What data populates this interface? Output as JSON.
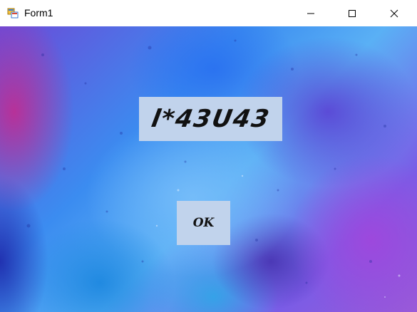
{
  "window": {
    "title": "Form1",
    "icon": "winforms-app-icon"
  },
  "titlebar_buttons": {
    "minimize": "minimize-icon",
    "maximize": "maximize-icon",
    "close": "close-icon"
  },
  "captcha": {
    "text": "l*43U43"
  },
  "ok_button": {
    "label": "OK"
  },
  "colors": {
    "panel_bg": "#c1d3ec",
    "text": "#111111",
    "titlebar_bg": "#ffffff"
  }
}
